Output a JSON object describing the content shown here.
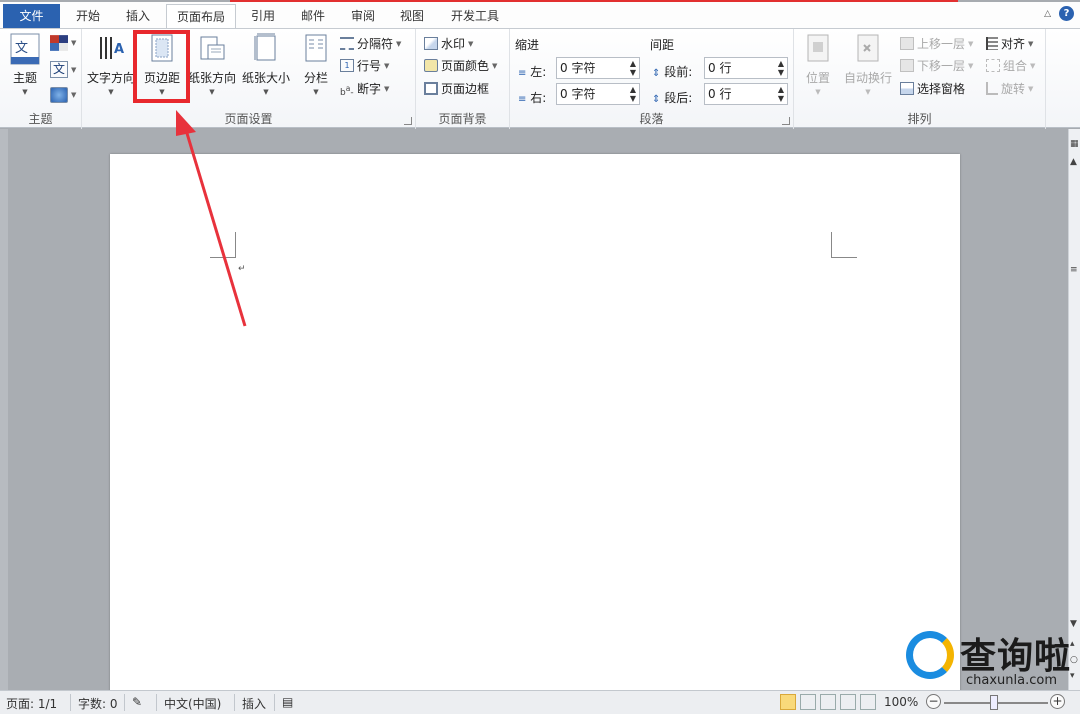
{
  "tabs": {
    "file": "文件",
    "items": [
      "开始",
      "插入",
      "页面布局",
      "引用",
      "邮件",
      "审阅",
      "视图",
      "开发工具"
    ],
    "active": "页面布局"
  },
  "ribbon": {
    "theme": {
      "label": "主题",
      "group": "主题"
    },
    "page_setup": {
      "group": "页面设置",
      "text_direction": "文字方向",
      "margins": "页边距",
      "orientation": "纸张方向",
      "size": "纸张大小",
      "columns": "分栏",
      "breaks": "分隔符",
      "line_numbers": "行号",
      "hyphenation": "断字"
    },
    "page_background": {
      "group": "页面背景",
      "watermark": "水印",
      "page_color": "页面颜色",
      "page_borders": "页面边框"
    },
    "paragraph": {
      "group": "段落",
      "indent_title": "缩进",
      "spacing_title": "间距",
      "left_label": "左:",
      "right_label": "右:",
      "before_label": "段前:",
      "after_label": "段后:",
      "left_value": "0 字符",
      "right_value": "0 字符",
      "before_value": "0 行",
      "after_value": "0 行"
    },
    "arrange": {
      "group": "排列",
      "position": "位置",
      "wrap_text": "自动换行",
      "bring_forward": "上移一层",
      "send_backward": "下移一层",
      "selection_pane": "选择窗格",
      "align": "对齐",
      "group_btn": "组合",
      "rotate": "旋转"
    }
  },
  "statusbar": {
    "page": "页面: 1/1",
    "words": "字数: 0",
    "language": "中文(中国)",
    "insert": "插入",
    "zoom": "100%",
    "zoom_level_percent": 100
  },
  "watermark": {
    "title": "查询啦",
    "domain": "chaxunla.com"
  },
  "colors": {
    "file_tab": "#2b62b0",
    "highlight": "#e8282d",
    "arrow": "#e8323c"
  }
}
